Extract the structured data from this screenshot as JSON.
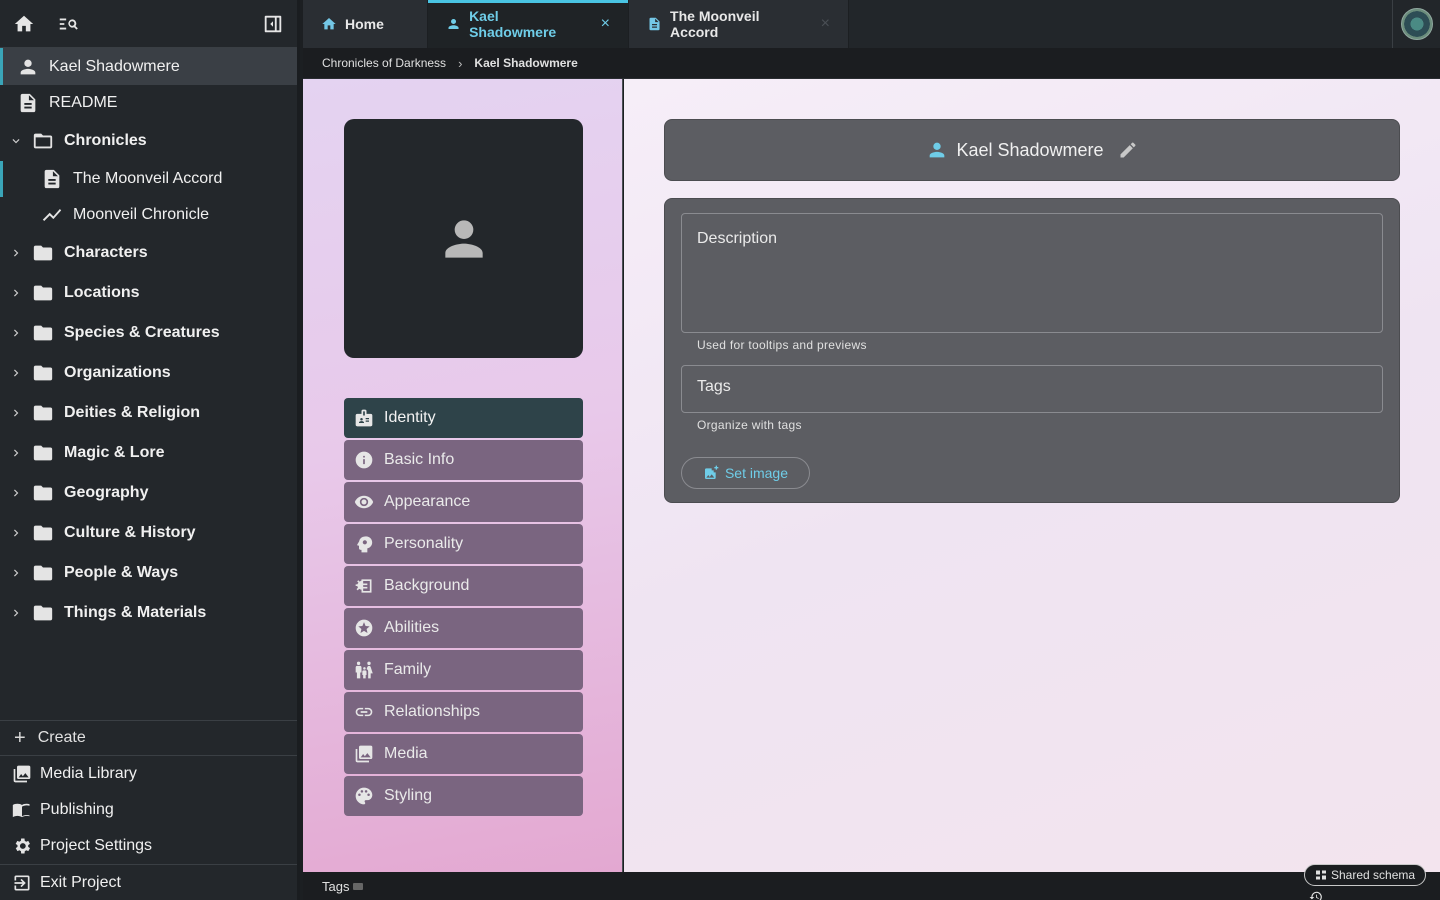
{
  "sidebar": {
    "tree": [
      {
        "label": "Kael Shadowmere",
        "icon": "person-icon",
        "state": "active"
      },
      {
        "label": "README",
        "icon": "document-icon"
      },
      {
        "label": "Chronicles",
        "icon": "folder-open-icon",
        "expanded": true
      },
      {
        "label": "The Moonveil Accord",
        "icon": "document-icon",
        "child": true
      },
      {
        "label": "Moonveil Chronicle",
        "icon": "timeline-icon",
        "child": true
      },
      {
        "label": "Characters",
        "icon": "folder-icon"
      },
      {
        "label": "Locations",
        "icon": "folder-icon"
      },
      {
        "label": "Species & Creatures",
        "icon": "folder-icon"
      },
      {
        "label": "Organizations",
        "icon": "folder-icon"
      },
      {
        "label": "Deities & Religion",
        "icon": "folder-icon"
      },
      {
        "label": "Magic & Lore",
        "icon": "folder-icon"
      },
      {
        "label": "Geography",
        "icon": "folder-icon"
      },
      {
        "label": "Culture & History",
        "icon": "folder-icon"
      },
      {
        "label": "People & Ways",
        "icon": "folder-icon"
      },
      {
        "label": "Things & Materials",
        "icon": "folder-icon"
      }
    ],
    "create_label": "Create",
    "media_library": "Media Library",
    "publishing": "Publishing",
    "project_settings": "Project Settings",
    "exit_project": "Exit Project"
  },
  "tabs": {
    "home": "Home",
    "active": "Kael Shadowmere",
    "doc": "The Moonveil Accord",
    "close_glyph": "×"
  },
  "breadcrumb": {
    "parent": "Chronicles of Darkness",
    "current": "Kael Shadowmere"
  },
  "nav": [
    {
      "label": "Identity",
      "icon": "id-badge-icon",
      "selected": true
    },
    {
      "label": "Basic Info",
      "icon": "info-icon"
    },
    {
      "label": "Appearance",
      "icon": "eye-icon"
    },
    {
      "label": "Personality",
      "icon": "head-icon"
    },
    {
      "label": "Background",
      "icon": "history-edu-icon"
    },
    {
      "label": "Abilities",
      "icon": "star-icon"
    },
    {
      "label": "Family",
      "icon": "family-icon"
    },
    {
      "label": "Relationships",
      "icon": "link-icon"
    },
    {
      "label": "Media",
      "icon": "photo-library-icon"
    },
    {
      "label": "Styling",
      "icon": "palette-icon"
    }
  ],
  "entity": {
    "title": "Kael Shadowmere"
  },
  "form": {
    "description_label": "Description",
    "description_hint": "Used for tooltips and previews",
    "tags_label": "Tags",
    "tags_hint": "Organize with tags",
    "set_image": "Set image"
  },
  "statusbar": {
    "tags": "Tags",
    "shared_schema": "Shared schema"
  },
  "colors": {
    "accent": "#49c4e3",
    "selected_nav": "#2e4349",
    "nav_button": "#7a6580",
    "card": "#5c5d62"
  }
}
